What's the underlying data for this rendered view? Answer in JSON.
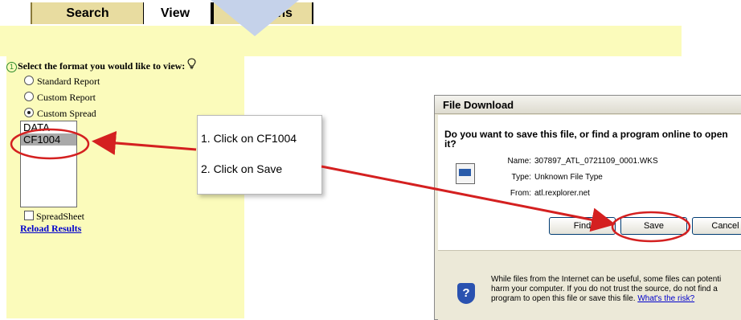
{
  "tabs": {
    "search": "Search",
    "view": "View",
    "preferences": "Pri     ptions"
  },
  "form": {
    "step_number": "1",
    "prompt": "Select the format you would like to view:",
    "options": [
      {
        "label": "Standard Report",
        "selected": false
      },
      {
        "label": "Custom Report",
        "selected": false
      },
      {
        "label": "Custom Spread",
        "selected": true
      }
    ],
    "list_items": [
      {
        "label": "DATA",
        "selected": false
      },
      {
        "label": "CF1004",
        "selected": true
      }
    ],
    "spreadsheet_label": "SpreadSheet",
    "spreadsheet_checked": false,
    "reload_link": "Reload Results"
  },
  "callout": {
    "step1": "1. Click on CF1004",
    "step2": "2. Click on Save"
  },
  "dialog": {
    "title": "File Download",
    "question_line1": "Do you want to save this file, or find a program online to open",
    "question_line2": "it?",
    "name_label": "Name:",
    "name_value": "307897_ATL_0721109_0001.WKS",
    "type_label": "Type:",
    "type_value": "Unknown File Type",
    "from_label": "From:",
    "from_value": "atl.rexplorer.net",
    "find_button": "Find",
    "save_button": "Save",
    "cancel_button": "Cancel",
    "warning_line1": "While files from the Internet can be useful, some files can potenti",
    "warning_line2": "harm your computer. If you do not trust the source, do not find a",
    "warning_line3": "program to open this file or save this file.",
    "risk_link": "What's the risk?"
  },
  "colors": {
    "tab_bg": "#e8dca0",
    "panel_yellow": "#fbfbbb",
    "annotation_red": "#d42020",
    "link_blue": "#0000cc",
    "dialog_bg": "#ece9d8"
  }
}
